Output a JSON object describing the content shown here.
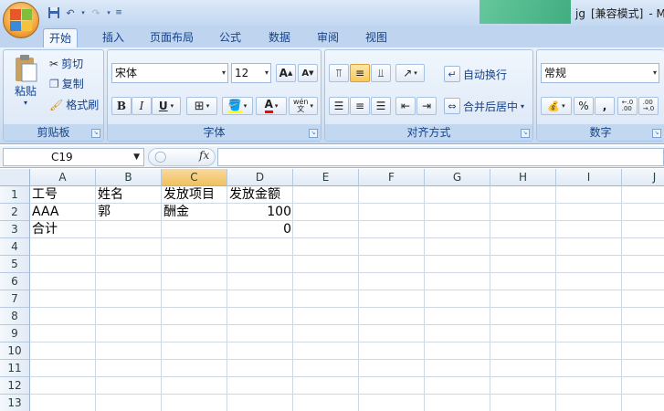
{
  "window": {
    "title_user": "jg",
    "title_mode": "[兼容模式]",
    "title_tail": "- M"
  },
  "tabs": [
    "开始",
    "插入",
    "页面布局",
    "公式",
    "数据",
    "审阅",
    "视图"
  ],
  "ribbon": {
    "clipboard": {
      "paste": "粘贴",
      "cut": "剪切",
      "copy": "复制",
      "format_painter": "格式刷",
      "label": "剪贴板"
    },
    "font": {
      "name": "宋体",
      "size": "12",
      "grow": "A",
      "shrink": "A",
      "bold": "B",
      "italic": "I",
      "underline": "U",
      "phonetic": "wén",
      "label": "字体"
    },
    "alignment": {
      "wrap_text": "自动换行",
      "merge_center": "合并后居中",
      "label": "对齐方式"
    },
    "number": {
      "format": "常规",
      "percent": "%",
      "comma": ",",
      "inc_decimal": ".0→.00",
      "dec_decimal": ".00→.0",
      "label": "数字"
    }
  },
  "formula_bar": {
    "name_box": "C19",
    "fx": "fx",
    "content": ""
  },
  "sheet": {
    "columns": [
      "A",
      "B",
      "C",
      "D",
      "E",
      "F",
      "G",
      "H",
      "I",
      "J"
    ],
    "rows": [
      "1",
      "2",
      "3",
      "4",
      "5",
      "6",
      "7",
      "8",
      "9",
      "10",
      "11",
      "12",
      "13"
    ],
    "selected_column": "C",
    "cells": {
      "A1": "工号",
      "B1": "姓名",
      "C1": "发放项目",
      "D1": "发放金额",
      "A2": "AAA",
      "B2": "郭",
      "C2": "酬金",
      "D2": "100",
      "A3": "合计",
      "D3": "0"
    }
  },
  "colors": {
    "accent": "#15428b",
    "selection_header": "#f1c15f",
    "gridline": "#d0d7e5"
  }
}
